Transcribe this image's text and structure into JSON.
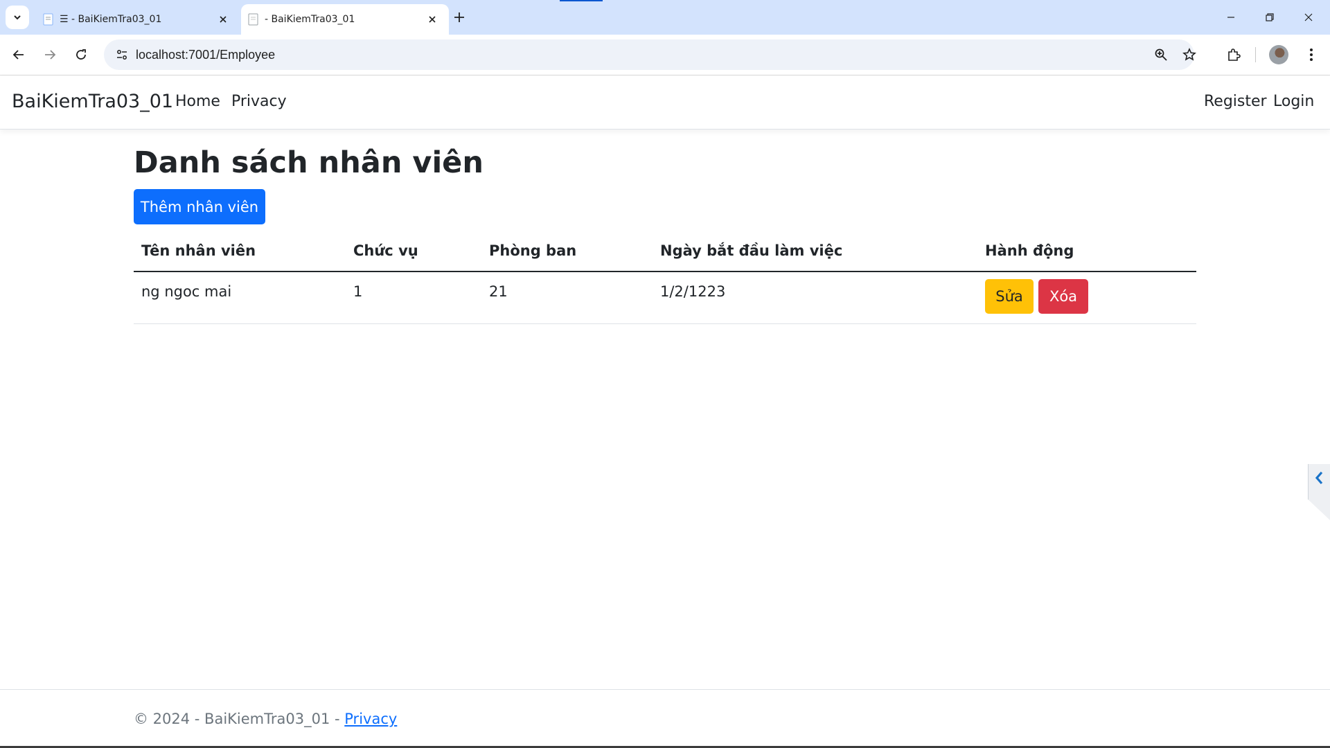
{
  "browser": {
    "tabs": [
      {
        "title": "☰ - BaiKiemTra03_01",
        "active": false
      },
      {
        "title": "- BaiKiemTra03_01",
        "active": true
      }
    ],
    "address": "localhost:7001/Employee"
  },
  "navbar": {
    "brand": "BaiKiemTra03_01",
    "links": [
      "Home",
      "Privacy"
    ],
    "right_links": [
      "Register",
      "Login"
    ]
  },
  "main": {
    "title": "Danh sách nhân viên",
    "add_button": "Thêm nhân viên",
    "table": {
      "headers": [
        "Tên nhân viên",
        "Chức vụ",
        "Phòng ban",
        "Ngày bắt đầu làm việc",
        "Hành động"
      ],
      "rows": [
        {
          "name": "ng ngoc mai",
          "position": "1",
          "department": "21",
          "start_date": "1/2/1223",
          "edit_label": "Sửa",
          "delete_label": "Xóa"
        }
      ]
    }
  },
  "footer": {
    "text": "© 2024 - BaiKiemTra03_01 - ",
    "link": "Privacy"
  },
  "colors": {
    "primary": "#0d6efd",
    "warning": "#ffc107",
    "danger": "#dc3545",
    "tabstrip": "#d3e3fd"
  }
}
